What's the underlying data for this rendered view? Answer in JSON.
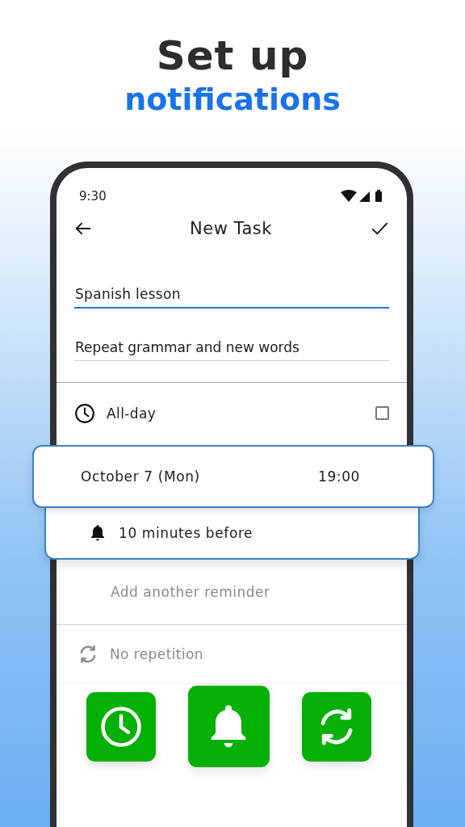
{
  "headline": {
    "line_1": "Set up",
    "line_2": "notifications"
  },
  "status_bar": {
    "time": "9:30"
  },
  "toolbar": {
    "title": "New Task"
  },
  "fields": [
    {
      "value": "Spanish lesson",
      "focused": true
    },
    {
      "value": "Repeat grammar and new words",
      "focused": false
    }
  ],
  "all_day": {
    "label": "All-day",
    "checked": false
  },
  "date_card": {
    "date": "October 7 (Mon)",
    "time": "19:00"
  },
  "reminder_card": {
    "label": "10 minutes before"
  },
  "add_reminder": {
    "label": "Add another reminder"
  },
  "repetition": {
    "label": "No repetition"
  },
  "feature_tiles": [
    {
      "kind": "clock"
    },
    {
      "kind": "bell"
    },
    {
      "kind": "repeat"
    }
  ]
}
